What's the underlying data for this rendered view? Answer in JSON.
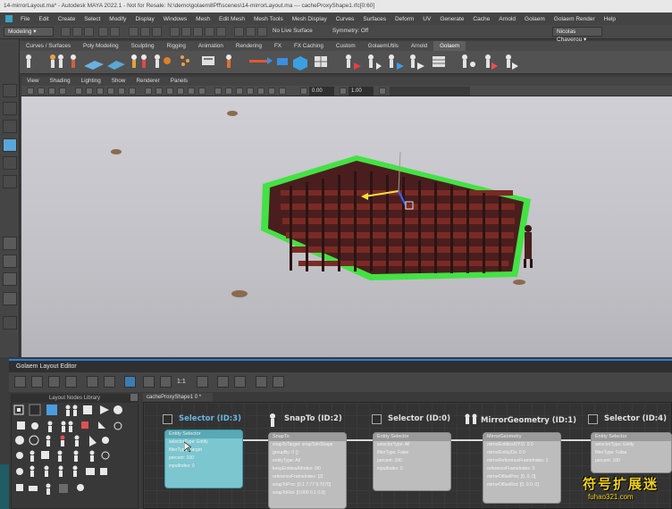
{
  "window": {
    "title": "14-mirrorLayout.ma* - Autodesk MAYA 2022.1 - Not for Resale: N:\\demo\\golaem8Pff\\scenes\\14-mirrorLayout.ma --- cacheProxyShape1.rfc[0:60]"
  },
  "menubar": [
    "File",
    "Edit",
    "Create",
    "Select",
    "Modify",
    "Display",
    "Windows",
    "Mesh",
    "Edit Mesh",
    "Mesh Tools",
    "Mesh Display",
    "Curves",
    "Surfaces",
    "Deform",
    "UV",
    "Generate",
    "Cache",
    "Arnold",
    "Golaem",
    "Golaem Render",
    "Help"
  ],
  "statusline": {
    "mode": "Modeling",
    "live_surface": "No Live Surface",
    "symmetry": "Symmetry: Off",
    "user": "Nicolas Chaverou"
  },
  "shelf_tabs": [
    "Curves / Surfaces",
    "Poly Modeling",
    "Sculpting",
    "Rigging",
    "Animation",
    "Rendering",
    "FX",
    "FX Caching",
    "Custom",
    "GolaemUtils",
    "Arnold",
    "Golaem"
  ],
  "shelf_active": "Golaem",
  "panel_menu": [
    "View",
    "Shading",
    "Lighting",
    "Show",
    "Renderer",
    "Panels"
  ],
  "view_toolbar": {
    "field_a": "0.00",
    "field_b": "1.00"
  },
  "editor": {
    "title": "Golaem Layout Editor",
    "zoom_label": "1:1",
    "library_title": "Layout Nodes Library",
    "graph_tab": "cacheProxyShape1 0 *",
    "nodes": [
      {
        "title": "Selector (ID:3)",
        "header": "Entity Selector",
        "rows": [
          "selectorType: Entity",
          "filterType: Target",
          "percent: 100",
          "inputIndex: 0"
        ]
      },
      {
        "title": "SnapTo (ID:2)",
        "header": "SnapTo",
        "rows": [
          "snapToTarget: snapToInShape",
          "groupBy: 0 ()",
          "entityType: All",
          "keepEntitiesAtIndex: 0/0",
          "referenceFrameIndex: [2]",
          "snapToPos: [0.1 7.77 9.7070]",
          "snapToRot: [0.000 0.1 0.0]"
        ]
      },
      {
        "title": "Selector (ID:0)",
        "header": "Entity Selector",
        "rows": [
          "selectorType: All",
          "filterType: False",
          "percent: 100",
          "inputIndex: 0"
        ]
      },
      {
        "title": "MirrorGeometry (ID:1)",
        "header": "MirrorGeometry",
        "rows": [
          "mirrorEntitiesX/Y/Z: 0 0",
          "mirrorEntityIDs: 0 0",
          "mirrorReferenceFrameIndex: 1",
          "referenceFrameIndex: 0",
          "mirrorOffsetPos: [0, 0, 0]",
          "mirrorOffsetRot: [0, 0.0, 0]"
        ]
      },
      {
        "title": "Selector (ID:4)",
        "header": "Entity Selector",
        "rows": [
          "selectorType: Entity",
          "filterType: False",
          "percent: 100"
        ]
      }
    ]
  },
  "watermark": {
    "cn": "符号扩展迷",
    "url": "fuhao321.com"
  },
  "colors": {
    "accent_blue": "#2a7fd4",
    "selection_green": "#3ce43c",
    "node_selected": "#5fb6c8",
    "watermark_yellow": "#f2d21a"
  }
}
